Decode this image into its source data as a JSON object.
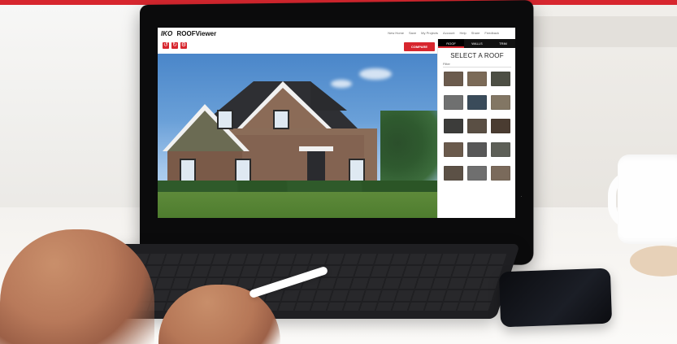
{
  "app": {
    "logo": "IKO",
    "product": "ROOFViewer"
  },
  "header_menu": [
    "New Home",
    "Save",
    "My Projects",
    "Account",
    "Help",
    "Share",
    "Feedback"
  ],
  "viewer": {
    "compare_label": "COMPARE",
    "tools": [
      "undo",
      "redo",
      "settings"
    ]
  },
  "panel": {
    "tabs": [
      "ROOF",
      "WALLS",
      "TRIM"
    ],
    "active_tab": "ROOF",
    "title": "SELECT A ROOF",
    "filter_label": "Filter",
    "swatches": [
      {
        "label": "",
        "color": "#6b5b4d"
      },
      {
        "label": "",
        "color": "#7b6a57"
      },
      {
        "label": "",
        "color": "#4d4f44"
      },
      {
        "label": "",
        "color": "#6f7070"
      },
      {
        "label": "",
        "color": "#3a4b5a"
      },
      {
        "label": "",
        "color": "#827664"
      },
      {
        "label": "",
        "color": "#3c3c3a"
      },
      {
        "label": "",
        "color": "#5a4f44"
      },
      {
        "label": "",
        "color": "#4a3c31"
      },
      {
        "label": "",
        "color": "#6a5a4c"
      },
      {
        "label": "",
        "color": "#585858"
      },
      {
        "label": "",
        "color": "#5d5f57"
      },
      {
        "label": "",
        "color": "#5c5146"
      },
      {
        "label": "",
        "color": "#6f6f6f"
      },
      {
        "label": "",
        "color": "#7a6a5b"
      }
    ]
  },
  "colors": {
    "accent": "#d7262e",
    "dark": "#0b0b0c"
  }
}
